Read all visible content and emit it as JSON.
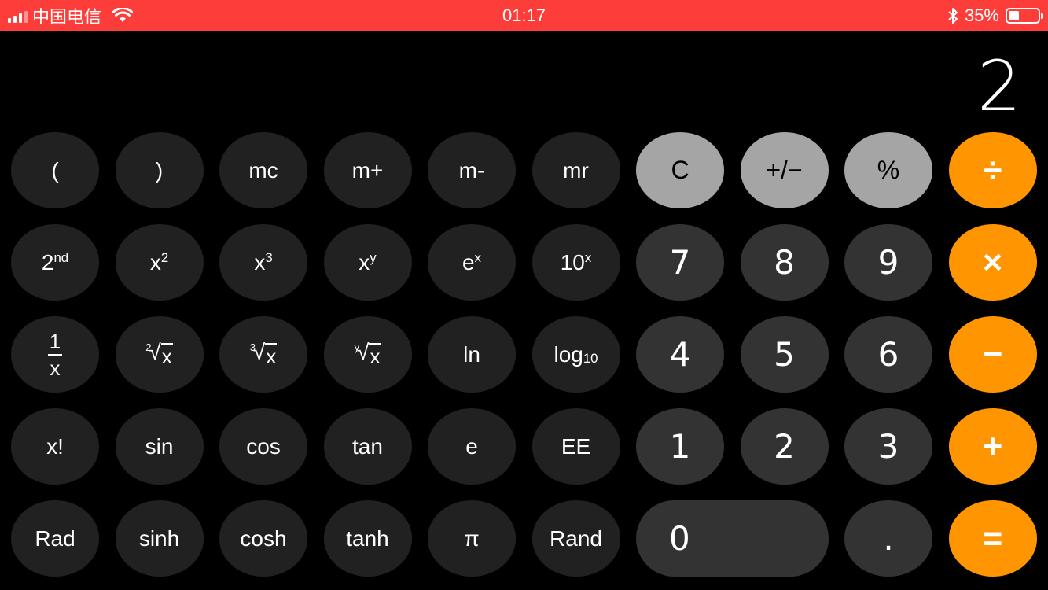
{
  "status_bar": {
    "carrier": "中国电信",
    "time": "01:17",
    "battery_percent": "35%",
    "battery_level": 0.35,
    "icons": [
      "signal-icon",
      "wifi-icon",
      "bluetooth-icon",
      "battery-icon"
    ]
  },
  "display": {
    "value": "2"
  },
  "keys": {
    "paren_open": "(",
    "paren_close": ")",
    "mc": "mc",
    "m_plus": "m+",
    "m_minus": "m-",
    "mr": "mr",
    "clear": "C",
    "plus_minus": "+/−",
    "percent": "%",
    "divide": "÷",
    "second": {
      "base": "2",
      "sup": "nd"
    },
    "x_squared": {
      "base": "x",
      "sup": "2"
    },
    "x_cubed": {
      "base": "x",
      "sup": "3"
    },
    "x_pow_y": {
      "base": "x",
      "sup": "y"
    },
    "e_pow_x": {
      "base": "e",
      "sup": "x"
    },
    "ten_pow_x": {
      "base": "10",
      "sup": "x"
    },
    "seven": "7",
    "eight": "8",
    "nine": "9",
    "multiply": "×",
    "reciprocal": {
      "num": "1",
      "den": "x"
    },
    "sqrt": {
      "index": "2",
      "radicand": "x"
    },
    "cbrt": {
      "index": "3",
      "radicand": "x"
    },
    "yroot": {
      "index": "y",
      "radicand": "x"
    },
    "ln": "ln",
    "log10": {
      "base": "log",
      "sub": "10"
    },
    "four": "4",
    "five": "5",
    "six": "6",
    "subtract": "−",
    "factorial": "x!",
    "sin": "sin",
    "cos": "cos",
    "tan": "tan",
    "e": "e",
    "ee": "EE",
    "one": "1",
    "two": "2",
    "three": "3",
    "add": "+",
    "rad": "Rad",
    "sinh": "sinh",
    "cosh": "cosh",
    "tanh": "tanh",
    "pi": "π",
    "rand": "Rand",
    "zero": "0",
    "decimal": ".",
    "equals": "="
  },
  "colors": {
    "status_bar": "#fc3d39",
    "operator": "#ff9500",
    "function": "#a5a5a5",
    "digit": "#333333",
    "scientific": "#212121"
  }
}
